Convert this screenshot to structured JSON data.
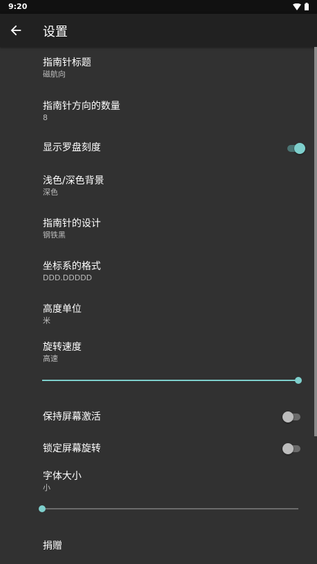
{
  "statusbar": {
    "time": "9:20"
  },
  "toolbar": {
    "title": "设置"
  },
  "prefs": {
    "compass_title": {
      "title": "指南针标题",
      "summary": "磁航向"
    },
    "direction_count": {
      "title": "指南针方向的数量",
      "summary": "8"
    },
    "show_scale": {
      "title": "显示罗盘刻度",
      "checked": true
    },
    "background": {
      "title": "浅色/深色背景",
      "summary": "深色"
    },
    "design": {
      "title": "指南针的设计",
      "summary": "钢铁黑"
    },
    "coord_format": {
      "title": "坐标系的格式",
      "summary": "DDD.DDDDD"
    },
    "height_unit": {
      "title": "高度单位",
      "summary": "米"
    },
    "rotation_speed": {
      "title": "旋转速度",
      "summary": "高速",
      "level": 1.0
    },
    "keep_screen_on": {
      "title": "保持屏幕激活",
      "checked": false
    },
    "lock_rotation": {
      "title": "锁定屏幕旋转",
      "checked": false
    },
    "font_size": {
      "title": "字体大小",
      "summary": "小",
      "level": 0.0
    },
    "donate": {
      "title": "捐赠"
    }
  },
  "colors": {
    "accent": "#7ecfcc",
    "accent_track": "#4b7473",
    "switch_off_thumb": "#bdbdbd",
    "switch_off_track": "#6b6b6b"
  }
}
